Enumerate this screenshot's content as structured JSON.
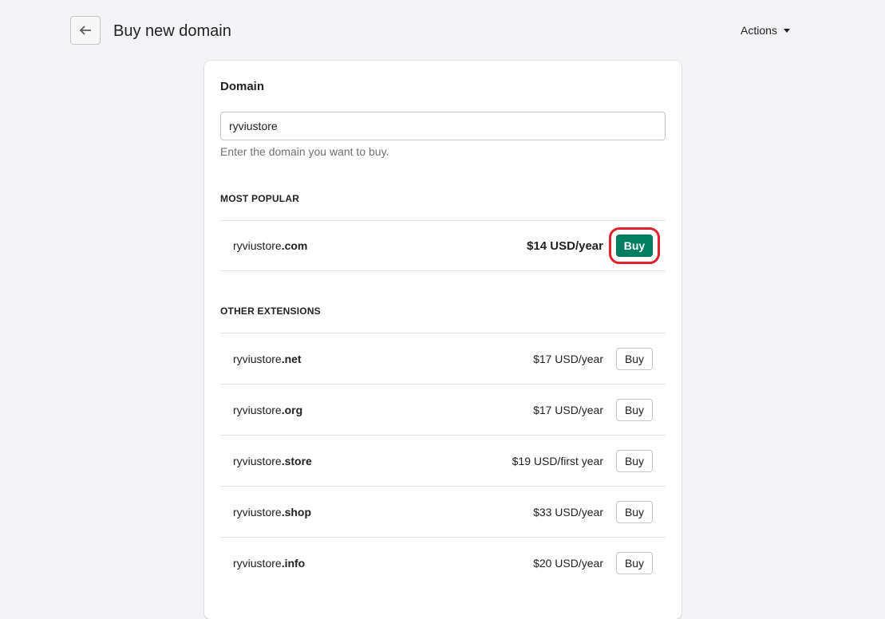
{
  "header": {
    "title": "Buy new domain",
    "actions_label": "Actions"
  },
  "card": {
    "heading": "Domain",
    "input_value": "ryviustore",
    "help": "Enter the domain you want to buy.",
    "popular_label": "MOST POPULAR",
    "other_label": "OTHER EXTENSIONS",
    "popular": {
      "base": "ryviustore",
      "ext": ".com",
      "price": "$14 USD/year",
      "button": "Buy"
    },
    "others": [
      {
        "base": "ryviustore",
        "ext": ".net",
        "price": "$17 USD/year",
        "button": "Buy"
      },
      {
        "base": "ryviustore",
        "ext": ".org",
        "price": "$17 USD/year",
        "button": "Buy"
      },
      {
        "base": "ryviustore",
        "ext": ".store",
        "price": "$19 USD/first year",
        "button": "Buy"
      },
      {
        "base": "ryviustore",
        "ext": ".shop",
        "price": "$33 USD/year",
        "button": "Buy"
      },
      {
        "base": "ryviustore",
        "ext": ".info",
        "price": "$20 USD/year",
        "button": "Buy"
      }
    ]
  },
  "colors": {
    "primary": "#008060",
    "highlight": "#e0202a"
  }
}
